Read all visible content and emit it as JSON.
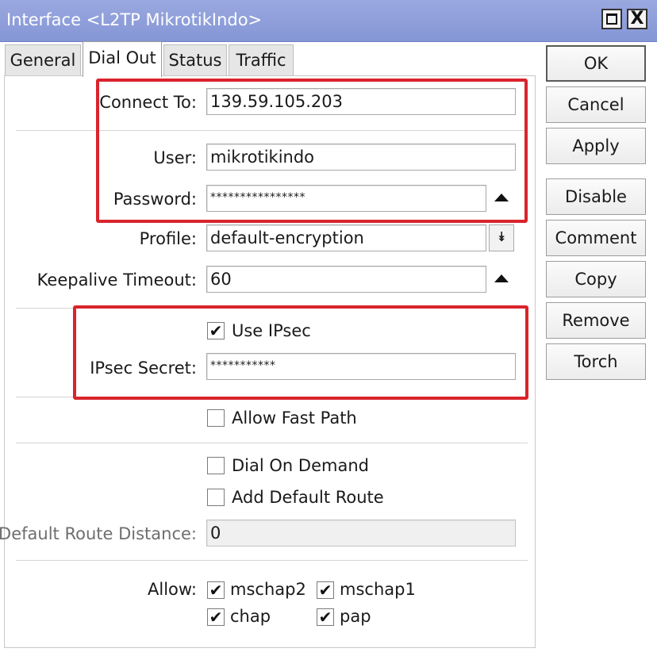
{
  "window": {
    "title": "Interface <L2TP MikrotikIndo>",
    "close_glyph": "X"
  },
  "tabs": [
    {
      "label": "General"
    },
    {
      "label": "Dial Out"
    },
    {
      "label": "Status"
    },
    {
      "label": "Traffic"
    }
  ],
  "form": {
    "connect_to": {
      "label": "Connect To:",
      "value": "139.59.105.203"
    },
    "user": {
      "label": "User:",
      "value": "mikrotikindo"
    },
    "password": {
      "label": "Password:",
      "value": "****************"
    },
    "profile": {
      "label": "Profile:",
      "value": "default-encryption"
    },
    "keepalive": {
      "label": "Keepalive Timeout:",
      "value": "60"
    },
    "use_ipsec": {
      "label": "Use IPsec",
      "checked": true
    },
    "ipsec_secret": {
      "label": "IPsec Secret:",
      "value": "***********"
    },
    "allow_fast_path": {
      "label": "Allow Fast Path",
      "checked": false
    },
    "dial_on_demand": {
      "label": "Dial On Demand",
      "checked": false
    },
    "add_default_route": {
      "label": "Add Default Route",
      "checked": false
    },
    "default_route_distance": {
      "label": "Default Route Distance:",
      "value": "0"
    },
    "allow": {
      "label": "Allow:",
      "options": [
        {
          "label": "mschap2",
          "checked": true
        },
        {
          "label": "mschap1",
          "checked": true
        },
        {
          "label": "chap",
          "checked": true
        },
        {
          "label": "pap",
          "checked": true
        }
      ]
    }
  },
  "buttons": {
    "ok": "OK",
    "cancel": "Cancel",
    "apply": "Apply",
    "disable": "Disable",
    "comment": "Comment",
    "copy": "Copy",
    "remove": "Remove",
    "torch": "Torch"
  },
  "icons": {
    "check": "✔",
    "arrow_up": "arrow-up-icon",
    "dropdown": "⯯"
  },
  "colors": {
    "titlebar": "#8f9fd9",
    "highlight": "#d9242c"
  }
}
